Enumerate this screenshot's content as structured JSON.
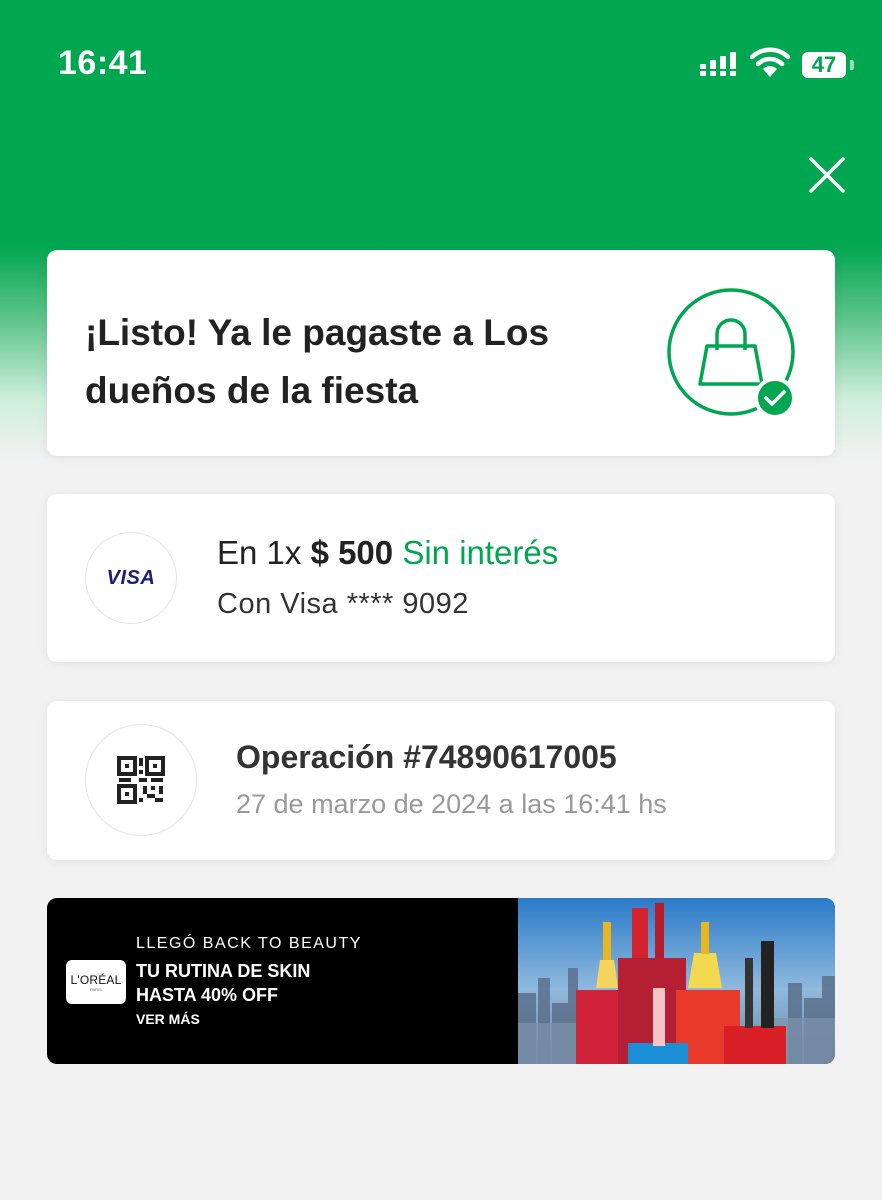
{
  "status_bar": {
    "time": "16:41",
    "battery": "47",
    "icons": [
      "cellular-signal-icon",
      "wifi-icon",
      "battery-icon"
    ]
  },
  "header": {
    "close_icon": "close-icon",
    "background_color": "#00a650"
  },
  "success_card": {
    "title": "¡Listo! Ya le pagaste a Los dueños de la fiesta",
    "icon": "shopping-bag-check-icon"
  },
  "payment_card": {
    "installments": "En 1x",
    "amount": "$ 500",
    "interest": "Sin interés",
    "card_info": "Con Visa **** 9092",
    "card_brand": "VISA"
  },
  "operation_card": {
    "title": "Operación #74890617005",
    "date": "27 de marzo de 2024 a las 16:41 hs",
    "icon": "qr-code-icon"
  },
  "banner": {
    "brand": "L'ORÉAL",
    "brand_sub": "PARIS",
    "kicker": "LLEGÓ BACK TO BEAUTY",
    "line1": "TU RUTINA DE SKIN",
    "line2": "HASTA 40% OFF",
    "cta": "VER MÁS"
  },
  "colors": {
    "accent": "#00a650",
    "visa_blue": "#1a1f71"
  }
}
